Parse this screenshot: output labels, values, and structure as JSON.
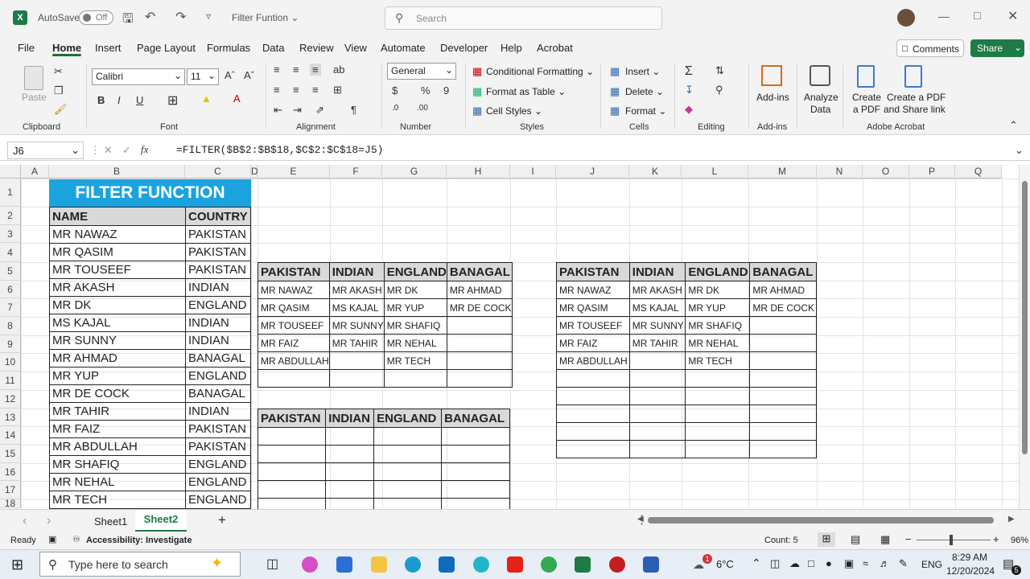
{
  "titlebar": {
    "autosave": "AutoSave",
    "toggle": "Off",
    "filename": "Filter Funtion",
    "search_placeholder": "Search"
  },
  "menu": [
    "File",
    "Home",
    "Insert",
    "Page Layout",
    "Formulas",
    "Data",
    "Review",
    "View",
    "Automate",
    "Developer",
    "Help",
    "Acrobat"
  ],
  "buttons": {
    "comments": "Comments",
    "share": "Share"
  },
  "ribbon": {
    "paste": "Paste",
    "font_name": "Calibri",
    "font_size": "11",
    "number_format": "General",
    "conditional": "Conditional Formatting",
    "format_table": "Format as Table",
    "cell_styles": "Cell Styles",
    "insert": "Insert",
    "delete": "Delete",
    "format": "Format",
    "addins": "Add-ins",
    "analyze1": "Analyze",
    "analyze2": "Data",
    "pdf1": "Create",
    "pdf2": "a PDF",
    "share1": "Create a PDF",
    "share2": "and Share link",
    "groups": {
      "clipboard": "Clipboard",
      "font": "Font",
      "alignment": "Alignment",
      "number": "Number",
      "styles": "Styles",
      "cells": "Cells",
      "editing": "Editing",
      "addins": "Add-ins",
      "acrobat": "Adobe Acrobat"
    }
  },
  "formula_bar": {
    "name_box": "J6",
    "fx": "fx",
    "formula": "=FILTER($B$2:$B$18,$C$2:$C$18=J5)"
  },
  "columns": [
    "A",
    "B",
    "C",
    "D",
    "E",
    "F",
    "G",
    "H",
    "I",
    "J",
    "K",
    "L",
    "M",
    "N",
    "O",
    "P",
    "Q"
  ],
  "rows": [
    "1",
    "2",
    "3",
    "4",
    "5",
    "6",
    "7",
    "8",
    "9",
    "10",
    "11",
    "12",
    "13",
    "14",
    "15",
    "16",
    "17",
    "18"
  ],
  "sheet": {
    "title": "FILTER FUNCTION",
    "headers": [
      "NAME",
      "COUNTRY"
    ],
    "data": [
      [
        "MR NAWAZ",
        "PAKISTAN"
      ],
      [
        "MR QASIM",
        "PAKISTAN"
      ],
      [
        "MR TOUSEEF",
        "PAKISTAN"
      ],
      [
        "MR AKASH",
        "INDIAN"
      ],
      [
        "MR DK",
        "ENGLAND"
      ],
      [
        "MS KAJAL",
        "INDIAN"
      ],
      [
        "MR SUNNY",
        "INDIAN"
      ],
      [
        "MR AHMAD",
        "BANAGAL"
      ],
      [
        "MR YUP",
        "ENGLAND"
      ],
      [
        "MR DE COCK",
        "BANAGAL"
      ],
      [
        "MR TAHIR",
        "INDIAN"
      ],
      [
        "MR FAIZ",
        "PAKISTAN"
      ],
      [
        "MR ABDULLAH",
        "PAKISTAN"
      ],
      [
        "MR SHAFIQ",
        "ENGLAND"
      ],
      [
        "MR NEHAL",
        "ENGLAND"
      ],
      [
        "MR TECH",
        "ENGLAND"
      ]
    ],
    "result_headers": [
      "PAKISTAN",
      "INDIAN",
      "ENGLAND",
      "BANAGAL"
    ],
    "result_rows": [
      [
        "MR NAWAZ",
        "MR AKASH",
        "MR DK",
        "MR AHMAD"
      ],
      [
        "MR QASIM",
        "MS KAJAL",
        "MR YUP",
        "MR DE COCK"
      ],
      [
        "MR TOUSEEF",
        "MR SUNNY",
        "MR SHAFIQ",
        ""
      ],
      [
        "MR FAIZ",
        "MR TAHIR",
        "MR NEHAL",
        ""
      ],
      [
        "MR ABDULLAH",
        "",
        "MR TECH",
        ""
      ],
      [
        "",
        "",
        "",
        ""
      ]
    ]
  },
  "sheets": [
    "Sheet1",
    "Sheet2"
  ],
  "status": {
    "ready": "Ready",
    "accessibility": "Accessibility: Investigate",
    "count": "Count: 5",
    "zoom": "96%"
  },
  "taskbar": {
    "search": "Type here to search",
    "temp": "6°C",
    "lang": "ENG",
    "time": "8:29 AM",
    "date": "12/20/2024",
    "badge": "1",
    "notif": "5"
  }
}
